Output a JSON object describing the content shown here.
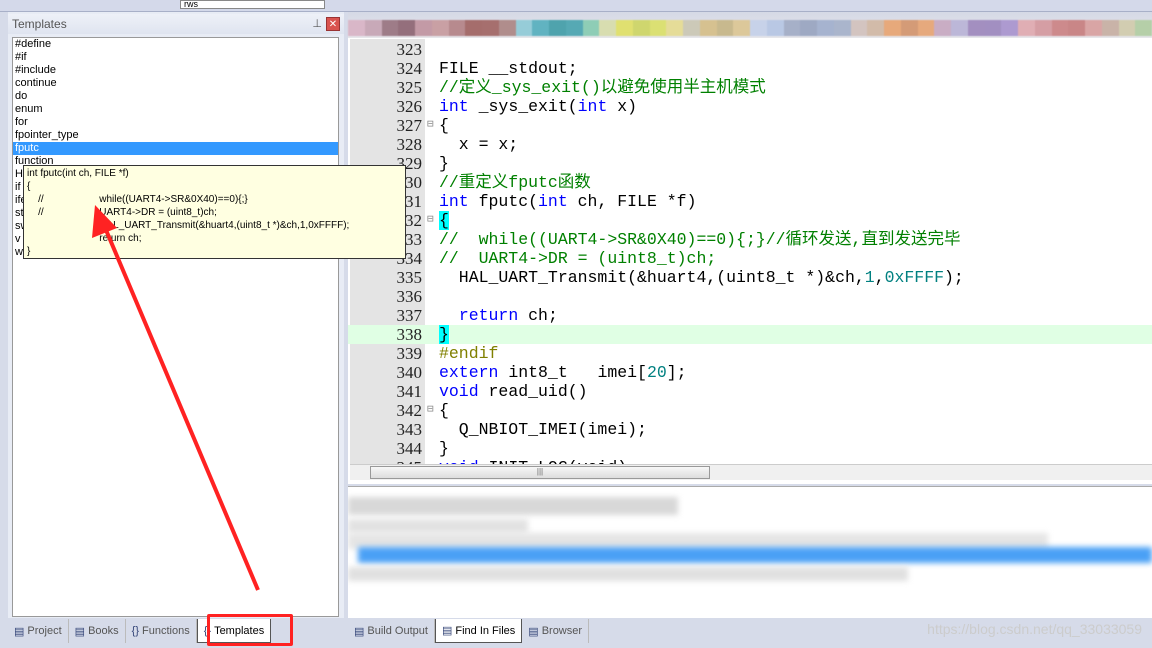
{
  "toolbar": {
    "combo_value": "rws"
  },
  "left_panel": {
    "title": "Templates",
    "pin_icon": "pin-icon",
    "close_icon": "close-icon",
    "items": [
      "#define",
      "#if",
      "#include",
      "continue",
      "do",
      "enum",
      "for",
      "fpointer_type",
      "fputc",
      "function",
      "H",
      "if",
      "ifelse",
      "struct",
      "switch",
      "v",
      "while"
    ],
    "selected": "fputc"
  },
  "tooltip": {
    "lines": [
      "int fputc(int ch, FILE *f)",
      "{",
      "    //                    while((UART4->SR&0X40)==0){;}",
      "    //                    UART4->DR = (uint8_t)ch;",
      "                          HAL_UART_Transmit(&huart4,(uint8_t *)&ch,1,0xFFFF);",
      "                          return ch;",
      "}"
    ]
  },
  "editor": {
    "current_line": 338,
    "lines": [
      {
        "n": "323",
        "fold": "",
        "t": []
      },
      {
        "n": "324",
        "fold": "",
        "t": [
          [
            "FILE __stdout;",
            ""
          ]
        ]
      },
      {
        "n": "325",
        "fold": "",
        "t": [
          [
            "//定义_sys_exit()以避免使用半主机模式",
            "cm"
          ]
        ]
      },
      {
        "n": "326",
        "fold": "",
        "t": [
          [
            "int",
            "kw"
          ],
          [
            " _sys_exit(",
            ""
          ],
          [
            "int",
            "kw"
          ],
          [
            " x)",
            ""
          ]
        ]
      },
      {
        "n": "327",
        "fold": "⊟",
        "t": [
          [
            "{",
            ""
          ]
        ]
      },
      {
        "n": "328",
        "fold": "",
        "t": [
          [
            "  x = x;",
            ""
          ]
        ]
      },
      {
        "n": "329",
        "fold": "",
        "t": [
          [
            "}",
            ""
          ]
        ]
      },
      {
        "n": "330",
        "fold": "",
        "t": [
          [
            "//重定义fputc函数",
            "cm"
          ]
        ]
      },
      {
        "n": "331",
        "fold": "",
        "t": [
          [
            "int",
            "kw"
          ],
          [
            " fputc(",
            ""
          ],
          [
            "int",
            "kw"
          ],
          [
            " ch, FILE *f)",
            ""
          ]
        ]
      },
      {
        "n": "332",
        "fold": "⊟",
        "t": [
          [
            "{",
            "br"
          ]
        ]
      },
      {
        "n": "333",
        "fold": "",
        "t": [
          [
            "//  while((UART4->SR&0X40)==0){;}//循环发送,直到发送完毕",
            "cm"
          ]
        ]
      },
      {
        "n": "334",
        "fold": "",
        "t": [
          [
            "//  UART4->DR = (uint8_t)ch;",
            "cm"
          ]
        ]
      },
      {
        "n": "335",
        "fold": "",
        "t": [
          [
            "  HAL_UART_Transmit(&huart4,(uint8_t *)&ch,",
            ""
          ],
          [
            "1",
            "num"
          ],
          [
            ",",
            ""
          ],
          [
            "0xFFFF",
            "num"
          ],
          [
            ");",
            ""
          ]
        ]
      },
      {
        "n": "336",
        "fold": "",
        "t": []
      },
      {
        "n": "337",
        "fold": "",
        "t": [
          [
            "  ",
            ""
          ],
          [
            "return",
            "kw"
          ],
          [
            " ch;",
            ""
          ]
        ]
      },
      {
        "n": "338",
        "fold": "",
        "t": [
          [
            "}",
            "br"
          ]
        ]
      },
      {
        "n": "339",
        "fold": "",
        "t": [
          [
            "#endif",
            "pp"
          ]
        ]
      },
      {
        "n": "340",
        "fold": "",
        "t": [
          [
            "extern",
            "kw"
          ],
          [
            " int8_t   imei[",
            ""
          ],
          [
            "20",
            "num"
          ],
          [
            "];",
            ""
          ]
        ]
      },
      {
        "n": "341",
        "fold": "",
        "t": [
          [
            "void",
            "kw"
          ],
          [
            " read_uid()",
            ""
          ]
        ]
      },
      {
        "n": "342",
        "fold": "⊟",
        "t": [
          [
            "{",
            ""
          ]
        ]
      },
      {
        "n": "343",
        "fold": "",
        "t": [
          [
            "  Q_NBIOT_IMEI(imei);",
            ""
          ]
        ]
      },
      {
        "n": "344",
        "fold": "",
        "t": [
          [
            "}",
            ""
          ]
        ]
      },
      {
        "n": "345",
        "fold": "",
        "t": [
          [
            "void",
            "kw"
          ],
          [
            " INIT_LOG(void)",
            ""
          ]
        ]
      }
    ]
  },
  "bottom_tabs_left": [
    {
      "label": "Project",
      "icon": "project-icon"
    },
    {
      "label": "Books",
      "icon": "books-icon"
    },
    {
      "label": "Functions",
      "icon": "functions-icon"
    },
    {
      "label": "Templates",
      "icon": "templates-icon",
      "active": true
    }
  ],
  "bottom_tabs_right": [
    {
      "label": "Build Output",
      "icon": "build-output-icon"
    },
    {
      "label": "Find In Files",
      "icon": "find-in-files-icon",
      "active": true
    },
    {
      "label": "Browser",
      "icon": "browser-icon"
    }
  ],
  "watermark": "https://blog.csdn.net/qq_33033059",
  "colors": {
    "selection": "#3399ff",
    "keyword": "#0000ff",
    "comment": "#008000",
    "annotation": "#ff2222",
    "current_line": "#e0ffe4"
  }
}
